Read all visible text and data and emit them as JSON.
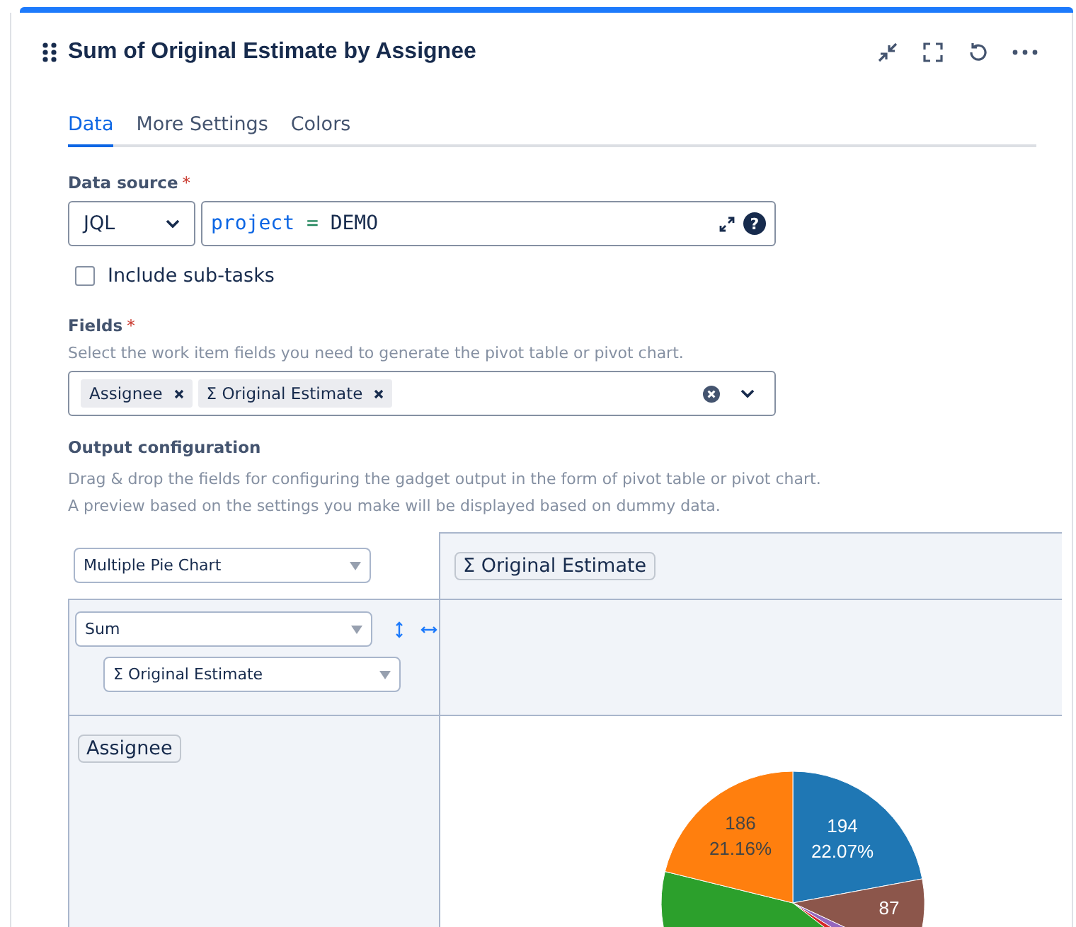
{
  "gadget": {
    "title": "Sum of Original Estimate by Assignee"
  },
  "tabs": [
    {
      "label": "Data",
      "selected": true
    },
    {
      "label": "More Settings",
      "selected": false
    },
    {
      "label": "Colors",
      "selected": false
    }
  ],
  "data_source": {
    "label": "Data source",
    "required": "*",
    "type": "JQL",
    "query_keyword": "project",
    "query_operator": "=",
    "query_value": "DEMO",
    "help": "?"
  },
  "include_subtasks": {
    "label": "Include sub-tasks",
    "checked": false
  },
  "fields": {
    "label": "Fields",
    "required": "*",
    "hint": "Select the work item fields you need to generate the pivot table or pivot chart.",
    "tags": [
      "Assignee",
      "Σ Original Estimate"
    ]
  },
  "output": {
    "label": "Output configuration",
    "hints": [
      "Drag & drop the fields for configuring the gadget output in the form of pivot table or pivot chart.",
      "A preview based on the settings you make will be displayed based on dummy data."
    ],
    "chart_type": "Multiple Pie Chart",
    "column_field": "Σ Original Estimate",
    "aggregation": "Sum",
    "value_field": "Σ Original Estimate",
    "row_field": "Assignee"
  },
  "pie": {
    "labels": [
      {
        "value": "186",
        "percent": "21.16%"
      },
      {
        "value": "194",
        "percent": "22.07%"
      },
      {
        "value": "87"
      }
    ]
  }
}
